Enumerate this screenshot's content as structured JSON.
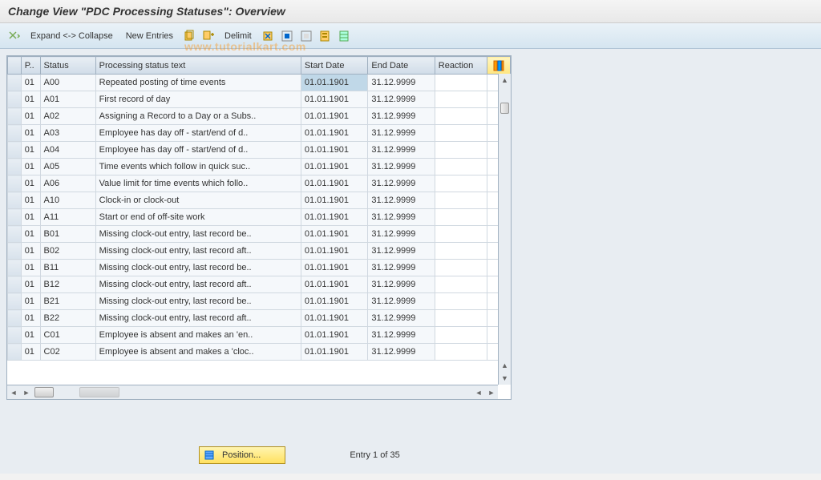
{
  "title": "Change View \"PDC Processing Statuses\": Overview",
  "watermark": "www.tutorialkart.com",
  "toolbar": {
    "expand_collapse": "Expand <-> Collapse",
    "new_entries": "New Entries",
    "delimit": "Delimit"
  },
  "columns": {
    "p": "P..",
    "status": "Status",
    "text": "Processing status text",
    "start": "Start Date",
    "end": "End Date",
    "reaction": "Reaction"
  },
  "rows": [
    {
      "p": "01",
      "status": "A00",
      "text": "Repeated posting of time events",
      "start": "01.01.1901",
      "end": "31.12.9999",
      "reaction": "",
      "selected": true
    },
    {
      "p": "01",
      "status": "A01",
      "text": "First record of day",
      "start": "01.01.1901",
      "end": "31.12.9999",
      "reaction": ""
    },
    {
      "p": "01",
      "status": "A02",
      "text": "Assigning a Record to a Day or a Subs..",
      "start": "01.01.1901",
      "end": "31.12.9999",
      "reaction": ""
    },
    {
      "p": "01",
      "status": "A03",
      "text": "Employee has day off - start/end of d..",
      "start": "01.01.1901",
      "end": "31.12.9999",
      "reaction": ""
    },
    {
      "p": "01",
      "status": "A04",
      "text": "Employee has day off - start/end of d..",
      "start": "01.01.1901",
      "end": "31.12.9999",
      "reaction": ""
    },
    {
      "p": "01",
      "status": "A05",
      "text": "Time events which follow in quick suc..",
      "start": "01.01.1901",
      "end": "31.12.9999",
      "reaction": ""
    },
    {
      "p": "01",
      "status": "A06",
      "text": "Value limit for time events which follo..",
      "start": "01.01.1901",
      "end": "31.12.9999",
      "reaction": ""
    },
    {
      "p": "01",
      "status": "A10",
      "text": "Clock-in or clock-out",
      "start": "01.01.1901",
      "end": "31.12.9999",
      "reaction": ""
    },
    {
      "p": "01",
      "status": "A11",
      "text": "Start or end of off-site work",
      "start": "01.01.1901",
      "end": "31.12.9999",
      "reaction": ""
    },
    {
      "p": "01",
      "status": "B01",
      "text": "Missing clock-out entry, last record be..",
      "start": "01.01.1901",
      "end": "31.12.9999",
      "reaction": ""
    },
    {
      "p": "01",
      "status": "B02",
      "text": "Missing clock-out entry, last record aft..",
      "start": "01.01.1901",
      "end": "31.12.9999",
      "reaction": ""
    },
    {
      "p": "01",
      "status": "B11",
      "text": "Missing clock-out entry, last record be..",
      "start": "01.01.1901",
      "end": "31.12.9999",
      "reaction": ""
    },
    {
      "p": "01",
      "status": "B12",
      "text": "Missing clock-out entry, last record aft..",
      "start": "01.01.1901",
      "end": "31.12.9999",
      "reaction": ""
    },
    {
      "p": "01",
      "status": "B21",
      "text": "Missing clock-out entry, last record be..",
      "start": "01.01.1901",
      "end": "31.12.9999",
      "reaction": ""
    },
    {
      "p": "01",
      "status": "B22",
      "text": "Missing clock-out entry, last record aft..",
      "start": "01.01.1901",
      "end": "31.12.9999",
      "reaction": ""
    },
    {
      "p": "01",
      "status": "C01",
      "text": "Employee is absent and makes an 'en..",
      "start": "01.01.1901",
      "end": "31.12.9999",
      "reaction": ""
    },
    {
      "p": "01",
      "status": "C02",
      "text": "Employee is absent and makes a 'cloc..",
      "start": "01.01.1901",
      "end": "31.12.9999",
      "reaction": ""
    }
  ],
  "footer": {
    "position_label": "Position...",
    "entry_info": "Entry 1 of 35"
  }
}
